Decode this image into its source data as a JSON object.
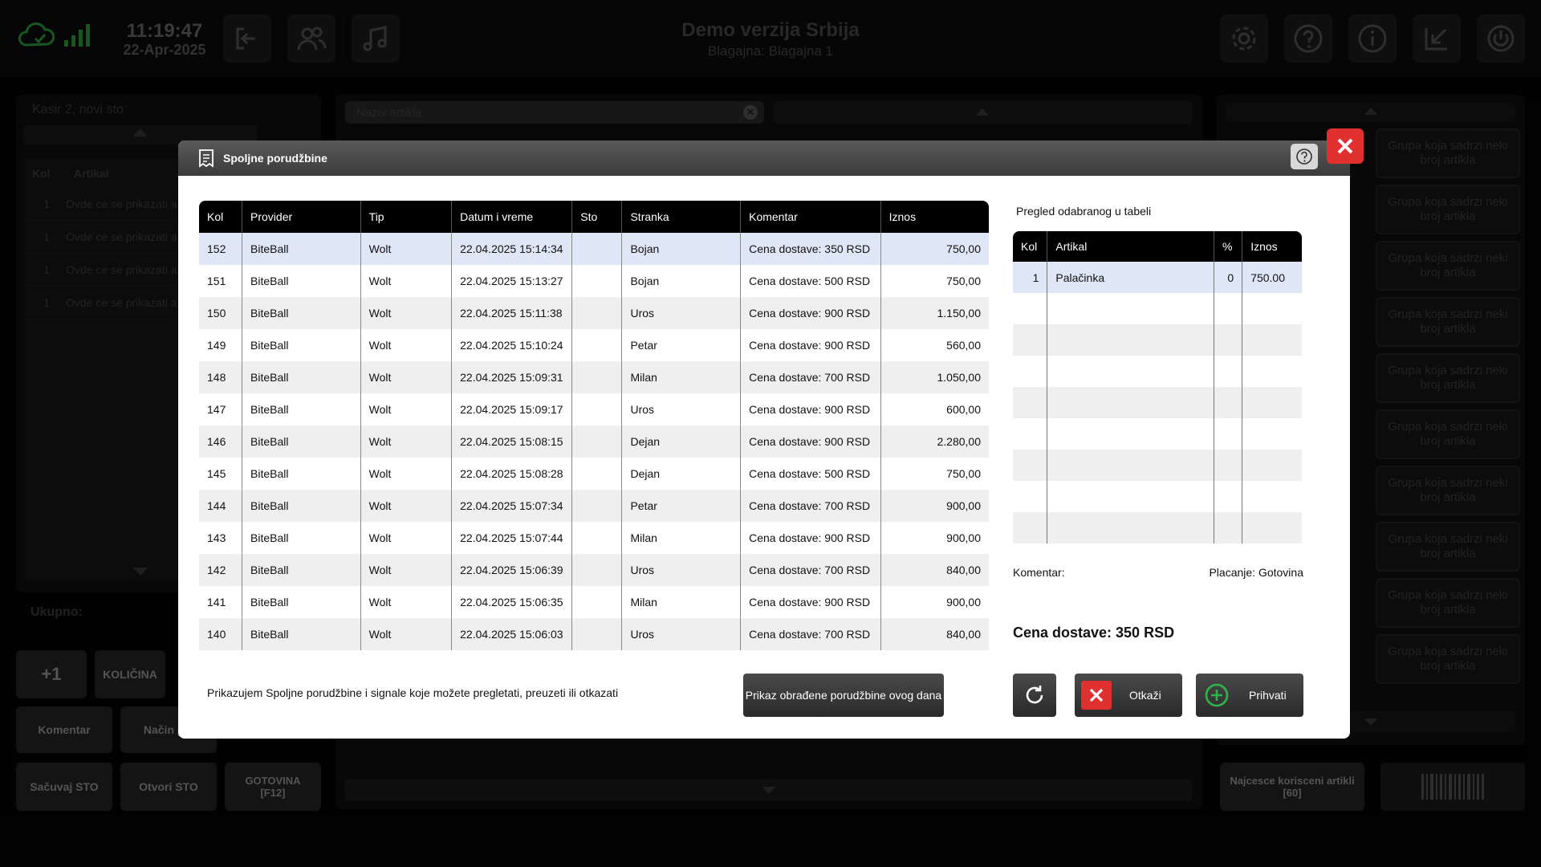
{
  "topbar": {
    "time": "11:19:47",
    "date": "22-Apr-2025",
    "title": "Demo verzija Srbija",
    "subtitle": "Blagajna: Blagajna 1"
  },
  "left_panel": {
    "header": "Kasir 2, novi sto",
    "col_kol": "Kol",
    "col_artikal": "Artikal",
    "rows": [
      {
        "kol": "1",
        "artikal": "Ovde ce se prikazati a"
      },
      {
        "kol": "1",
        "artikal": "Ovde ce se prikazati a"
      },
      {
        "kol": "1",
        "artikal": "Ovde ce se prikazati a"
      },
      {
        "kol": "1",
        "artikal": "Ovde ce se prikazati a"
      }
    ],
    "ukupno": "Ukupno:",
    "buttons": {
      "plus_one": "+1",
      "kolicina": "KOLIČINA",
      "komentar": "Komentar",
      "nacin": "Način pla",
      "sacuvaj": "Sačuvaj STO",
      "otvori": "Otvori STO",
      "gotovina": "GOTOVINA\n[F12]"
    }
  },
  "center_panel": {
    "search_placeholder": "Naziv artikla"
  },
  "right_panel": {
    "group_label": "Grupa koja sadrzi neki broj artikla",
    "najcesce": "Najcesce korisceni artikli [60]"
  },
  "dialog": {
    "title": "Spoljne porudžbine",
    "columns": [
      "Kol",
      "Provider",
      "Tip",
      "Datum i vreme",
      "Sto",
      "Stranka",
      "Komentar",
      "Iznos"
    ],
    "orders": [
      {
        "kol": "152",
        "provider": "BiteBall",
        "tip": "Wolt",
        "datum": "22.04.2025  15:14:34",
        "sto": "",
        "stranka": "Bojan",
        "komentar": "Cena dostave: 350 RSD",
        "iznos": "750,00"
      },
      {
        "kol": "151",
        "provider": "BiteBall",
        "tip": "Wolt",
        "datum": "22.04.2025  15:13:27",
        "sto": "",
        "stranka": "Bojan",
        "komentar": "Cena dostave: 500 RSD",
        "iznos": "750,00"
      },
      {
        "kol": "150",
        "provider": "BiteBall",
        "tip": "Wolt",
        "datum": "22.04.2025  15:11:38",
        "sto": "",
        "stranka": "Uros",
        "komentar": "Cena dostave: 900 RSD",
        "iznos": "1.150,00"
      },
      {
        "kol": "149",
        "provider": "BiteBall",
        "tip": "Wolt",
        "datum": "22.04.2025  15:10:24",
        "sto": "",
        "stranka": "Petar",
        "komentar": "Cena dostave: 900 RSD",
        "iznos": "560,00"
      },
      {
        "kol": "148",
        "provider": "BiteBall",
        "tip": "Wolt",
        "datum": "22.04.2025  15:09:31",
        "sto": "",
        "stranka": "Milan",
        "komentar": "Cena dostave: 700 RSD",
        "iznos": "1.050,00"
      },
      {
        "kol": "147",
        "provider": "BiteBall",
        "tip": "Wolt",
        "datum": "22.04.2025  15:09:17",
        "sto": "",
        "stranka": "Uros",
        "komentar": "Cena dostave: 900 RSD",
        "iznos": "600,00"
      },
      {
        "kol": "146",
        "provider": "BiteBall",
        "tip": "Wolt",
        "datum": "22.04.2025  15:08:15",
        "sto": "",
        "stranka": "Dejan",
        "komentar": "Cena dostave: 900 RSD",
        "iznos": "2.280,00"
      },
      {
        "kol": "145",
        "provider": "BiteBall",
        "tip": "Wolt",
        "datum": "22.04.2025  15:08:28",
        "sto": "",
        "stranka": "Dejan",
        "komentar": "Cena dostave: 500 RSD",
        "iznos": "750,00"
      },
      {
        "kol": "144",
        "provider": "BiteBall",
        "tip": "Wolt",
        "datum": "22.04.2025  15:07:34",
        "sto": "",
        "stranka": "Petar",
        "komentar": "Cena dostave: 700 RSD",
        "iznos": "900,00"
      },
      {
        "kol": "143",
        "provider": "BiteBall",
        "tip": "Wolt",
        "datum": "22.04.2025  15:07:44",
        "sto": "",
        "stranka": "Milan",
        "komentar": "Cena dostave: 900 RSD",
        "iznos": "900,00"
      },
      {
        "kol": "142",
        "provider": "BiteBall",
        "tip": "Wolt",
        "datum": "22.04.2025  15:06:39",
        "sto": "",
        "stranka": "Uros",
        "komentar": "Cena dostave: 700 RSD",
        "iznos": "840,00"
      },
      {
        "kol": "141",
        "provider": "BiteBall",
        "tip": "Wolt",
        "datum": "22.04.2025  15:06:35",
        "sto": "",
        "stranka": "Milan",
        "komentar": "Cena dostave: 900 RSD",
        "iznos": "900,00"
      },
      {
        "kol": "140",
        "provider": "BiteBall",
        "tip": "Wolt",
        "datum": "22.04.2025  15:06:03",
        "sto": "",
        "stranka": "Uros",
        "komentar": "Cena dostave: 700 RSD",
        "iznos": "840,00"
      }
    ],
    "preview_title": "Pregled odabranog u tabeli",
    "preview_columns": [
      "Kol",
      "Artikal",
      "%",
      "Iznos"
    ],
    "preview_rows": [
      {
        "kol": "1",
        "artikal": "Palačinka",
        "pct": "0",
        "iznos": "750.00"
      }
    ],
    "komentar_label": "Komentar:",
    "placanje": "Placanje: Gotovina",
    "cena_dostave": "Cena dostave: 350 RSD",
    "info_text": "Prikazujem Spoljne porudžbine i signale koje možete pregletati, preuzeti ili otkazati",
    "btn_prikaz": "Prikaz obrađene porudžbine ovog dana",
    "btn_otkazi": "Otkaži",
    "btn_prihvati": "Prihvati"
  },
  "colors": {
    "accent_red": "#e03030",
    "accept_green": "#2fb34a",
    "selected_row": "#dfe6f6",
    "status_green": "#2e9e3e"
  }
}
